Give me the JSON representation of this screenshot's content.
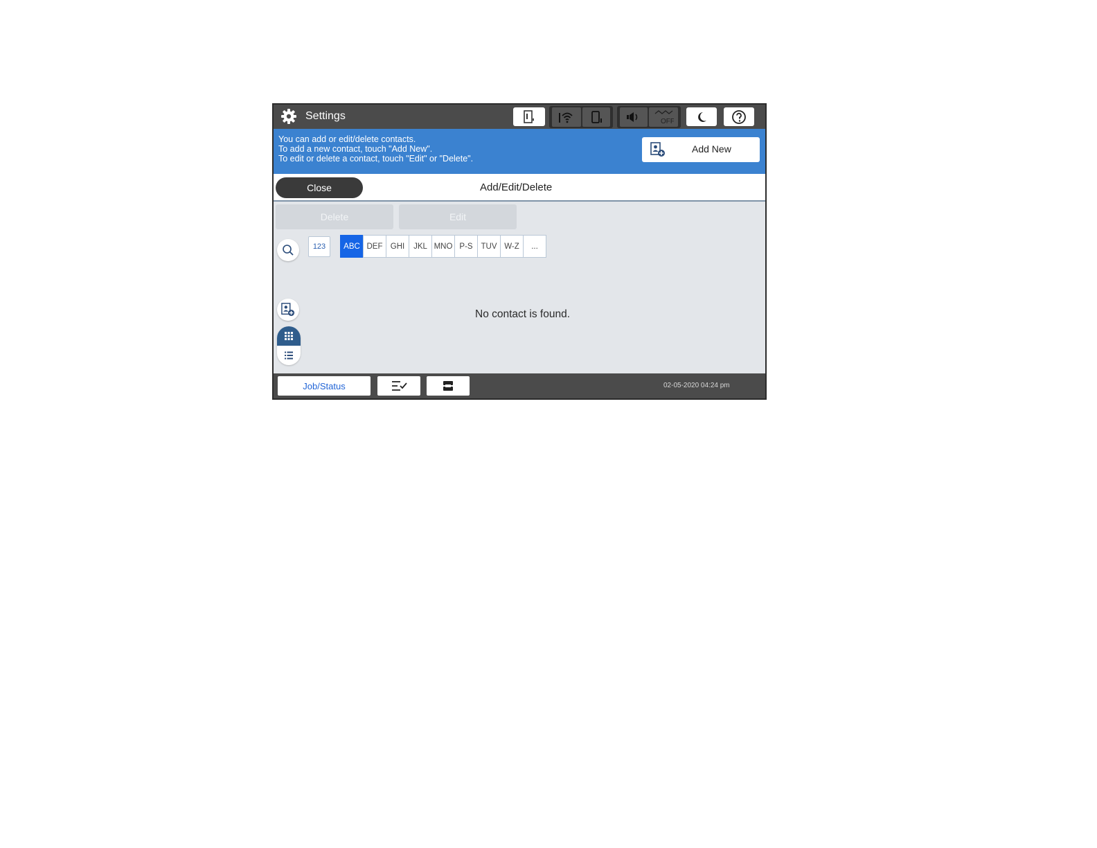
{
  "header": {
    "title": "Settings",
    "icons": [
      "gear-icon",
      "ink-icon",
      "wifi-icon",
      "wifi-direct-icon",
      "speaker-icon",
      "fax-off-icon",
      "sleep-moon-icon",
      "help-icon"
    ],
    "fax_off_label": "OFF"
  },
  "info": {
    "lines": [
      "You can add or edit/delete contacts.",
      "To add a new contact, touch \"Add New\".",
      "To edit or delete a contact, touch \"Edit\" or \"Delete\"."
    ],
    "add_new_label": "Add New"
  },
  "titlebar": {
    "close_label": "Close",
    "title": "Add/Edit/Delete"
  },
  "actions": {
    "delete_label": "Delete",
    "edit_label": "Edit"
  },
  "index": {
    "numeric_label": "123",
    "tabs": [
      "ABC",
      "DEF",
      "GHI",
      "JKL",
      "MNO",
      "P-S",
      "TUV",
      "W-Z",
      "..."
    ],
    "active_tab": "ABC"
  },
  "content": {
    "empty_message": "No contact is found."
  },
  "footer": {
    "job_status_label": "Job/Status",
    "timestamp": "02-05-2020 04:24 pm"
  },
  "colors": {
    "header_bg": "#4b4b4b",
    "info_bar_bg": "#3b82d0",
    "active_tab": "#1665e6",
    "body_bg": "#e3e6ea"
  }
}
